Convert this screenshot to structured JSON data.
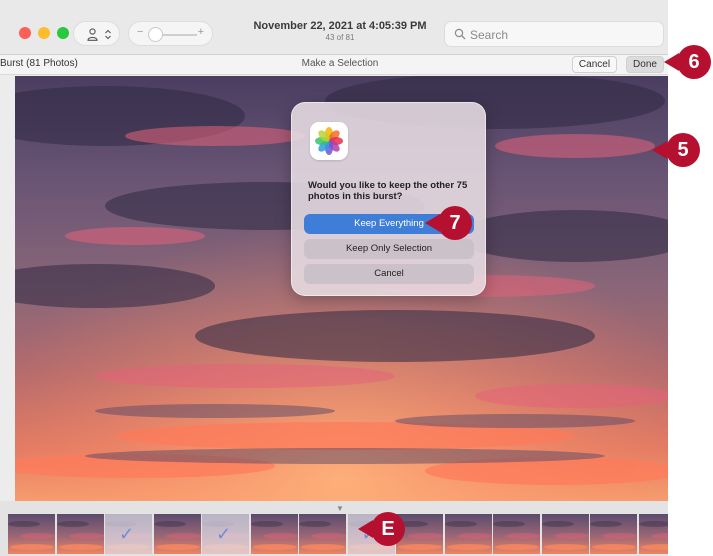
{
  "titlebar": {
    "date": "November 22, 2021 at 4:05:39 PM",
    "count": "43 of 81",
    "search_placeholder": "Search",
    "zoom_minus": "−",
    "zoom_plus": "+"
  },
  "subbar": {
    "burst_label": "Burst (81 Photos)",
    "title": "Make a Selection",
    "cancel_label": "Cancel",
    "done_label": "Done"
  },
  "dialog": {
    "message": "Would you like to keep the other 75 photos in this burst?",
    "keep_everything": "Keep Everything",
    "keep_only_selection": "Keep Only Selection",
    "cancel": "Cancel"
  },
  "filmstrip": {
    "arrow": "▼",
    "thumbnails": [
      {
        "checked": false
      },
      {
        "checked": false
      },
      {
        "checked": true
      },
      {
        "checked": false
      },
      {
        "checked": true
      },
      {
        "checked": false
      },
      {
        "checked": false
      },
      {
        "checked": true
      },
      {
        "checked": false
      },
      {
        "checked": false
      },
      {
        "checked": false
      },
      {
        "checked": false
      },
      {
        "checked": false
      },
      {
        "checked": false
      }
    ],
    "check_glyph": "✓"
  },
  "callouts": {
    "six": "6",
    "five": "5",
    "seven": "7",
    "e": "E"
  },
  "colors": {
    "accent": "#3f7ed8",
    "callout": "#b5102f"
  },
  "icons": [
    "person-icon",
    "updown-chevron-icon",
    "search-icon",
    "photos-app-icon",
    "checkmark-icon"
  ]
}
